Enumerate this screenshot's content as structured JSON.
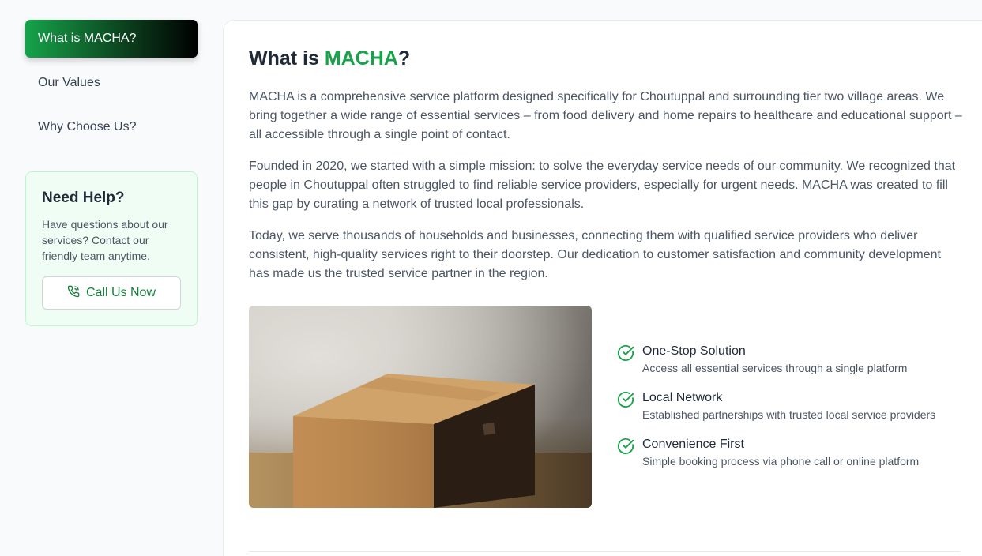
{
  "sidebar": {
    "items": [
      {
        "label": "What is MACHA?",
        "active": true
      },
      {
        "label": "Our Values",
        "active": false
      },
      {
        "label": "Why Choose Us?",
        "active": false
      }
    ],
    "help": {
      "title": "Need Help?",
      "text": "Have questions about our services? Contact our friendly team anytime.",
      "button_label": "Call Us Now",
      "button_icon": "phone-icon"
    }
  },
  "main": {
    "title_prefix": "What is ",
    "title_accent": "MACHA",
    "title_suffix": "?",
    "paragraphs": [
      "MACHA is a comprehensive service platform designed specifically for Choutuppal and surrounding tier two village areas. We bring together a wide range of essential services – from food delivery and home repairs to healthcare and educational support – all accessible through a single point of contact.",
      "Founded in 2020, we started with a simple mission: to solve the everyday service needs of our community. We recognized that people in Choutuppal often struggled to find reliable service providers, especially for urgent needs. MACHA was created to fill this gap by curating a network of trusted local professionals.",
      "Today, we serve thousands of households and businesses, connecting them with qualified service providers who deliver consistent, high-quality services right to their doorstep. Our dedication to customer satisfaction and community development has made us the trusted service partner in the region."
    ],
    "features": [
      {
        "title": "One-Stop Solution",
        "desc": "Access all essential services through a single platform",
        "icon": "check-circle-icon"
      },
      {
        "title": "Local Network",
        "desc": "Established partnerships with trusted local service providers",
        "icon": "check-circle-icon"
      },
      {
        "title": "Convenience First",
        "desc": "Simple booking process via phone call or online platform",
        "icon": "check-circle-icon"
      }
    ]
  },
  "colors": {
    "accent": "#16a34a",
    "help_bg": "#f0fdf4",
    "text_body": "#4b5563"
  }
}
